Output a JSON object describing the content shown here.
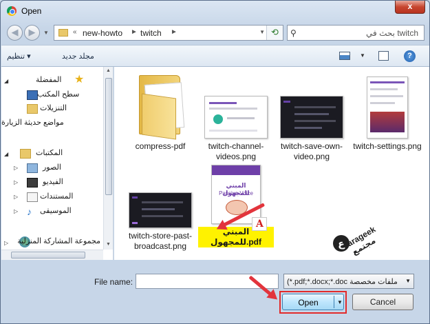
{
  "window": {
    "title": "Open",
    "close_glyph": "x"
  },
  "address": {
    "crumbs": [
      "new-howto",
      "twitch"
    ],
    "separators": [
      "«",
      "►",
      "►"
    ],
    "search_placeholder": "بحث في twitch"
  },
  "commands": {
    "organize": "تنظيم ▾",
    "new_folder": "مجلد جديد"
  },
  "nav_pane": {
    "favorites": "المفضلة",
    "desktop": "سطح المكتب",
    "downloads": "التنزيلات",
    "recent_places": "مواضع حديثة الزيارة",
    "libraries": "المكتبات",
    "pictures": "الصور",
    "videos": "الفيديو",
    "documents": "المستندات",
    "music": "الموسيقى",
    "homegroup": "مجموعة المشاركة المنزلية"
  },
  "files": [
    {
      "name": "compress-pdf"
    },
    {
      "name": "twitch-channel-videos.png"
    },
    {
      "name": "twitch-save-own-video.png"
    },
    {
      "name": "twitch-settings.png"
    },
    {
      "name": "twitch-store-past-broadcast.png"
    },
    {
      "name": "المبني للمجهول.pdf",
      "selected": true
    }
  ],
  "pdf_thumb": {
    "title": "المبني للمجهول",
    "subtitle": "Passive Voice"
  },
  "watermark": {
    "letter": "ع",
    "text": "arageek مجتمع"
  },
  "footer": {
    "file_name_label": "File name:",
    "file_name_value": "",
    "file_type": "(*.pdf;*.docx;*.doc ملفات مخصصة",
    "open_label": "Open",
    "cancel_label": "Cancel"
  },
  "colors": {
    "highlight": "#fff200",
    "annotation": "#e2343c"
  }
}
